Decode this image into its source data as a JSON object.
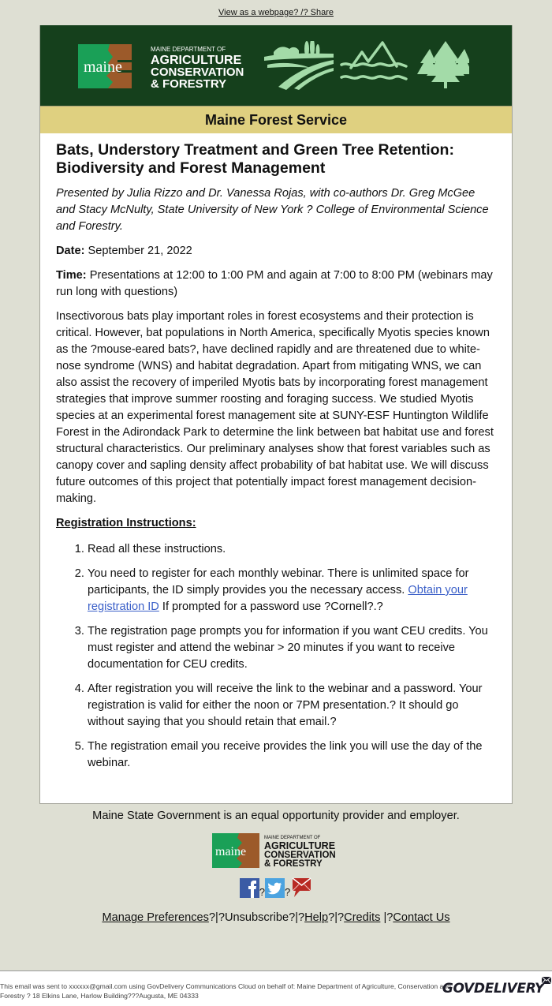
{
  "topbar": {
    "view_link": "View as a webpage? /? Share"
  },
  "banner": {
    "logo_word": "maine",
    "logo_line1": "MAINE DEPARTMENT OF",
    "logo_line2": "AGRICULTURE",
    "logo_line3": "CONSERVATION",
    "logo_line4": "& FORESTRY",
    "icons": [
      "farm-fields-icon",
      "mountain-water-icon",
      "pine-trees-icon"
    ]
  },
  "service_name": "Maine Forest Service",
  "article": {
    "title": "Bats, Understory Treatment and Green Tree Retention: Biodiversity and Forest Management",
    "presenters": "Presented by Julia Rizzo and Dr. Vanessa Rojas, with co-authors Dr. Greg McGee and Stacy McNulty, State University of New York ? College of Environmental Science and Forestry.",
    "date_label": "Date:",
    "date_value": " September 21, 2022",
    "time_label": "Time:",
    "time_value": " Presentations at 12:00 to 1:00 PM and again at 7:00 to 8:00 PM (webinars may run long with questions)",
    "body": "Insectivorous bats play important roles in forest ecosystems and their protection is critical. However, bat populations in North America, specifically Myotis species known as the ?mouse-eared bats?, have declined rapidly and are threatened due to white-nose syndrome (WNS) and habitat degradation. Apart from mitigating WNS, we can also assist the recovery of imperiled Myotis bats by incorporating forest management strategies that improve summer roosting and foraging success. We studied Myotis species at an experimental forest management site at SUNY-ESF Huntington Wildlife Forest in the Adirondack Park to determine the link between bat habitat use and forest structural characteristics. Our preliminary analyses show that forest variables such as canopy cover and sapling density affect probability of bat habitat use. We will discuss future outcomes of this project that potentially impact forest management decision-making.",
    "registration_heading": "Registration Instructions:",
    "steps": [
      {
        "text": "Read all these instructions."
      },
      {
        "text": "You need to register for each monthly webinar. There is unlimited space for participants, the ID simply provides you the necessary access. ",
        "link": "Obtain your registration ID",
        "after": " If prompted for a password use ?Cornell?.?"
      },
      {
        "text": "The registration page prompts you for information if you want CEU credits. You must register and attend the webinar > 20 minutes if you want to receive documentation for CEU credits."
      },
      {
        "text": "After registration you will receive the link to the webinar and a password. Your registration is valid for either the noon or 7PM presentation.? It should go without saying that you should retain that email.?"
      },
      {
        "text": "The registration email you receive provides the link you will use the day of the webinar."
      }
    ]
  },
  "footer": {
    "eop": "Maine State Government is an equal opportunity provider and employer.",
    "social_sep": "?",
    "links": {
      "manage": "Manage Preferences",
      "sep1": "?|?",
      "unsubscribe": "Unsubscribe",
      "sep2": "?|?",
      "help": "Help",
      "sep3": "?|?",
      "credits": "Credits",
      "sep4": " |?",
      "contact": "Contact Us"
    }
  },
  "bottom": {
    "disclaimer": "This email was sent to xxxxxx@gmail.com using GovDelivery Communications Cloud on behalf of: Maine Department of Agriculture, Conservation and Forestry ? 18 Elkins Lane, Harlow Building???Augusta, ME 04333",
    "brand": "GOVDELIVERY"
  },
  "colors": {
    "banner_green": "#15401c",
    "service_gold": "#dfd080",
    "logo_green": "#1aa057",
    "logo_brown": "#9c5a2a",
    "icon_mint": "#a3dba8",
    "link_blue": "#3a5fc8",
    "page_bg": "#dedfd3"
  }
}
